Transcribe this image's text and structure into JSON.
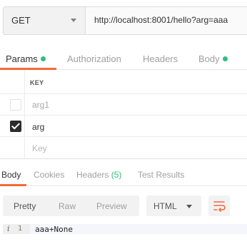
{
  "request": {
    "method": "GET",
    "url": "http://localhost:8001/hello?arg=aaa"
  },
  "request_tabs": [
    {
      "label": "Params",
      "has_dot": true,
      "active": true
    },
    {
      "label": "Authorization",
      "has_dot": false,
      "active": false
    },
    {
      "label": "Headers",
      "has_dot": false,
      "active": false
    },
    {
      "label": "Body",
      "has_dot": true,
      "active": false
    }
  ],
  "params_table": {
    "key_header": "KEY",
    "rows": [
      {
        "key": "arg1",
        "checked": false,
        "disabled": true
      },
      {
        "key": "arg",
        "checked": true,
        "disabled": false
      }
    ],
    "new_key_placeholder": "Key"
  },
  "response_tabs": [
    {
      "label": "Body",
      "active": true
    },
    {
      "label": "Cookies",
      "active": false
    },
    {
      "label": "Headers",
      "count": "(5)",
      "active": false
    },
    {
      "label": "Test Results",
      "active": false
    }
  ],
  "view_modes": [
    "Pretty",
    "Raw",
    "Preview"
  ],
  "format_select": "HTML",
  "response_body": {
    "line_number": "1",
    "info_marker": "i",
    "text": "aaa+None"
  },
  "colors": {
    "accent": "#f26b3a",
    "dot_green": "#2ebf7a"
  },
  "icons": [
    "chevron-down-icon",
    "checkbox-icon",
    "wrap-lines-icon",
    "info-icon"
  ]
}
